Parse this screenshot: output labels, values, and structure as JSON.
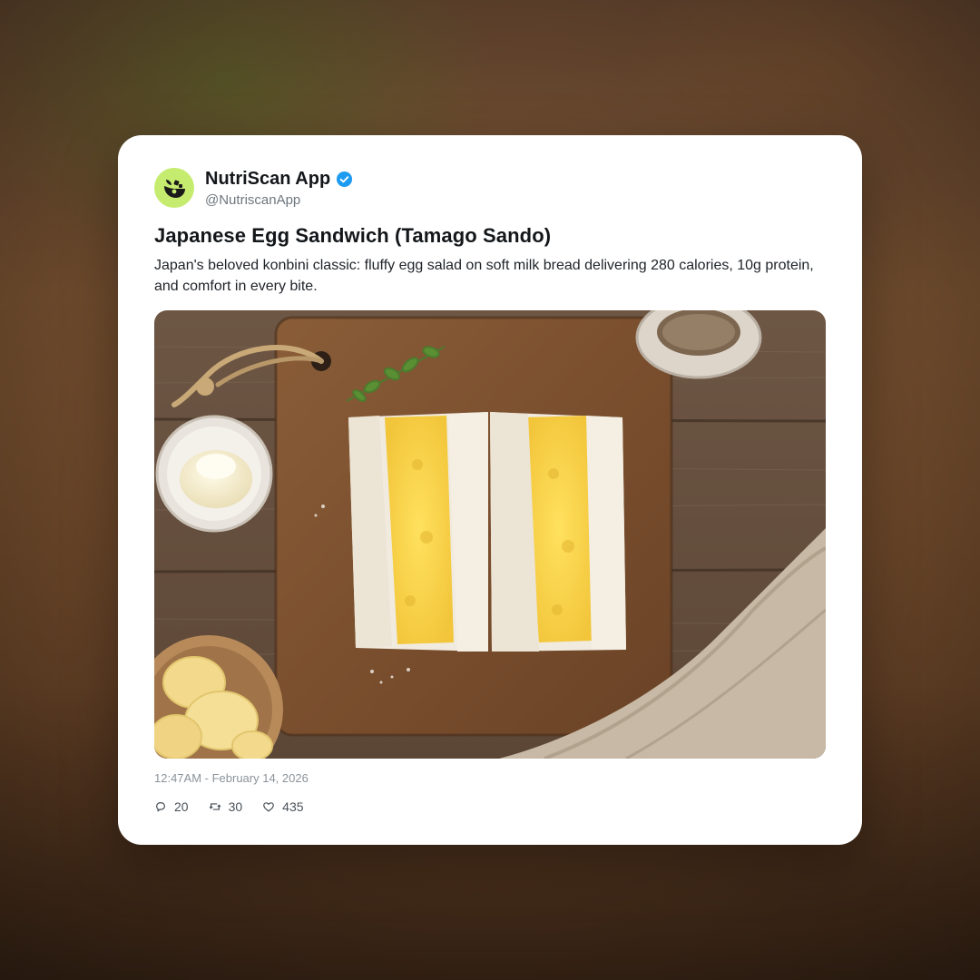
{
  "post": {
    "author_name": "NutriScan App",
    "author_handle": "@NutriscanApp",
    "verified": true,
    "title": "Japanese Egg Sandwich (Tamago Sando)",
    "description": "Japan's beloved konbini classic: fluffy egg salad on soft milk bread delivering 280 calories, 10g protein, and comfort in every bite.",
    "timestamp": "12:47AM - February 14, 2026",
    "stats": {
      "replies": "20",
      "reposts": "30",
      "likes": "435"
    }
  },
  "icons": {
    "avatar": "nutriscan-logo-icon",
    "verified": "verified-badge-icon",
    "replies": "reply-icon",
    "reposts": "repost-icon",
    "likes": "heart-icon"
  },
  "colors": {
    "avatar_bg": "#c6ec6f",
    "verified": "#1d9bf0",
    "text_primary": "#14171a",
    "text_secondary": "#6e767d"
  }
}
